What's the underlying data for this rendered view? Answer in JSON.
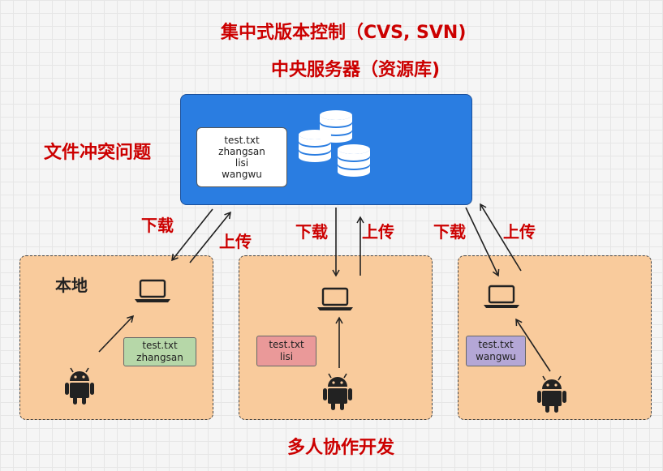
{
  "title": "集中式版本控制（CVS, SVN)",
  "subtitle": "中央服务器（资源库)",
  "conflict_label": "文件冲突问题",
  "bottom_label": "多人协作开发",
  "server": {
    "files": [
      "test.txt",
      "zhangsan",
      "lisi",
      "wangwu"
    ],
    "color": "#2a7de1"
  },
  "arrows": {
    "download": "下载",
    "upload": "上传"
  },
  "clients": [
    {
      "label": "本地",
      "file": "test.txt",
      "user": "zhangsan",
      "note_color": "#b6d7a8"
    },
    {
      "label": "",
      "file": "test.txt",
      "user": "lisi",
      "note_color": "#ea9999"
    },
    {
      "label": "",
      "file": "test.txt",
      "user": "wangwu",
      "note_color": "#b4a7d6"
    }
  ],
  "colors": {
    "accent_red": "#cc0000",
    "panel_fill": "#f9cb9c"
  }
}
